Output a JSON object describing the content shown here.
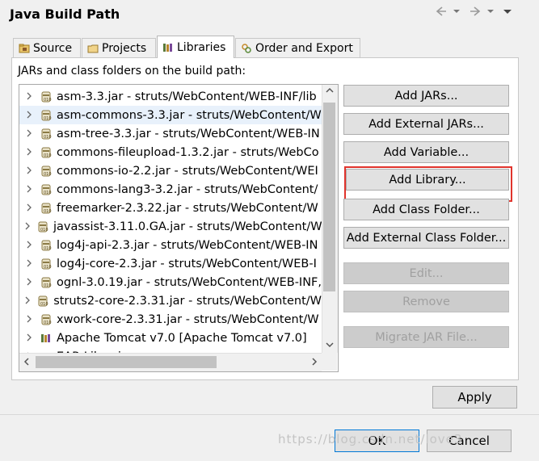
{
  "window": {
    "title": "Java Build Path"
  },
  "tabs": [
    {
      "label": "Source",
      "icon": "source-folder-icon",
      "active": false
    },
    {
      "label": "Projects",
      "icon": "projects-icon",
      "active": false
    },
    {
      "label": "Libraries",
      "icon": "libraries-icon",
      "active": true
    },
    {
      "label": "Order and Export",
      "icon": "order-export-icon",
      "active": false
    }
  ],
  "panel": {
    "label": "JARs and class folders on the build path:"
  },
  "tree": {
    "items": [
      {
        "text": "asm-3.3.jar - struts/WebContent/WEB-INF/lib",
        "icon": "jar-icon"
      },
      {
        "text": "asm-commons-3.3.jar - struts/WebContent/W",
        "icon": "jar-icon",
        "selected": true
      },
      {
        "text": "asm-tree-3.3.jar - struts/WebContent/WEB-IN",
        "icon": "jar-icon"
      },
      {
        "text": "commons-fileupload-1.3.2.jar - struts/WebCo",
        "icon": "jar-icon"
      },
      {
        "text": "commons-io-2.2.jar - struts/WebContent/WEI",
        "icon": "jar-icon"
      },
      {
        "text": "commons-lang3-3.2.jar - struts/WebContent/",
        "icon": "jar-icon"
      },
      {
        "text": "freemarker-2.3.22.jar - struts/WebContent/W",
        "icon": "jar-icon"
      },
      {
        "text": "javassist-3.11.0.GA.jar - struts/WebContent/W",
        "icon": "jar-icon"
      },
      {
        "text": "log4j-api-2.3.jar - struts/WebContent/WEB-IN",
        "icon": "jar-icon"
      },
      {
        "text": "log4j-core-2.3.jar - struts/WebContent/WEB-I",
        "icon": "jar-icon"
      },
      {
        "text": "ognl-3.0.19.jar - struts/WebContent/WEB-INF,",
        "icon": "jar-icon"
      },
      {
        "text": "struts2-core-2.3.31.jar - struts/WebContent/W",
        "icon": "jar-icon"
      },
      {
        "text": "xwork-core-2.3.31.jar - struts/WebContent/W",
        "icon": "jar-icon"
      },
      {
        "text": "Apache Tomcat v7.0 [Apache Tomcat v7.0]",
        "icon": "library-icon"
      },
      {
        "text": "EAR Libraries",
        "icon": "library-icon"
      }
    ]
  },
  "buttons": {
    "add_jars": "Add JARs...",
    "add_external_jars": "Add External JARs...",
    "add_variable": "Add Variable...",
    "add_library": "Add Library...",
    "add_class_folder": "Add Class Folder...",
    "add_external_class_folder": "Add External Class Folder...",
    "edit": "Edit...",
    "remove": "Remove",
    "migrate_jar": "Migrate JAR File...",
    "apply": "Apply",
    "ok": "OK",
    "cancel": "Cancel"
  },
  "watermark": "https://blog.csdn.net/love3",
  "colors": {
    "highlight": "#e0342c",
    "selection": "#e8f1fb"
  }
}
